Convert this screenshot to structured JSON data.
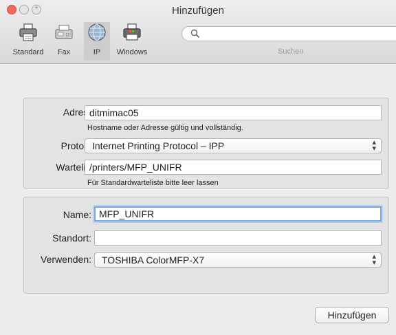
{
  "window": {
    "title": "Hinzufügen"
  },
  "toolbar": {
    "items": [
      {
        "label": "Standard",
        "icon": "printer-icon"
      },
      {
        "label": "Fax",
        "icon": "fax-icon"
      },
      {
        "label": "IP",
        "icon": "globe-icon"
      },
      {
        "label": "Windows",
        "icon": "windows-printer-icon"
      }
    ],
    "selected": "IP",
    "search_label": "Suchen",
    "search_value": ""
  },
  "connection": {
    "address_label": "Adresse:",
    "address_value": "ditmimac05",
    "address_hint": "Hostname oder Adresse gültig und vollständig.",
    "protocol_label": "Protokoll:",
    "protocol_value": "Internet Printing Protocol – IPP",
    "queue_label": "Warteliste:",
    "queue_value": "/printers/MFP_UNIFR",
    "queue_hint": "Für Standardwarteliste bitte leer lassen"
  },
  "printer": {
    "name_label": "Name:",
    "name_value": "MFP_UNIFR",
    "location_label": "Standort:",
    "location_value": "",
    "use_label": "Verwenden:",
    "use_value": "TOSHIBA ColorMFP-X7"
  },
  "footer": {
    "add_button": "Hinzufügen"
  },
  "colors": {
    "close": "#ef6a5e",
    "focus": "#7aa7e0"
  }
}
